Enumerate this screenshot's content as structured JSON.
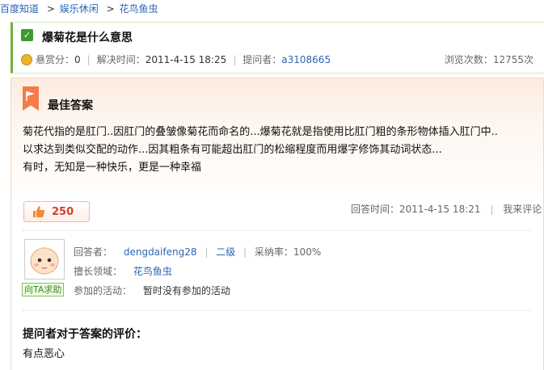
{
  "breadcrumb": {
    "items": [
      "百度知道",
      "娱乐休闲",
      "花鸟鱼虫"
    ],
    "separator": ">"
  },
  "question": {
    "title": "爆菊花是什么意思",
    "reward_label": "悬赏分：",
    "reward_value": "0",
    "solved_label": "解决时间：",
    "solved_time": "2011-4-15 18:25",
    "asker_label": "提问者：",
    "asker": "a3108665",
    "views_label": "浏览次数：",
    "views": "12755次"
  },
  "answer": {
    "section_title": "最佳答案",
    "lines": [
      "菊花代指的是肛门..因肛门的叠皱像菊花而命名的...爆菊花就是指使用比肛门粗的条形物体插入肛门中..",
      "以求达到类似交配的动作...因其粗条有可能超出肛门的松缩程度而用爆字修饰其动词状态...",
      "有时，无知是一种快乐，更是一种幸福"
    ],
    "likes": "250",
    "answer_time_label": "回答时间：",
    "answer_time": "2011-4-15 18:21",
    "comment_link": "我来评论"
  },
  "answerer": {
    "help_button": "向TA求助",
    "name_label": "回答者：",
    "name": "dengdaifeng28",
    "level": "二级",
    "adopt_label": "采纳率：",
    "adopt_rate": "100%",
    "field_label": "擅长领域：",
    "field": "花鸟鱼虫",
    "activity_label": "参加的活动：",
    "activity": "暂时没有参加的活动"
  },
  "evaluation": {
    "title": "提问者对于答案的评价：",
    "text": "有点恶心"
  },
  "colors": {
    "link": "#2d64b3",
    "accent_green": "#6fb33a",
    "best_answer_flag": "#f37c4a",
    "like_count": "#d2402a"
  }
}
